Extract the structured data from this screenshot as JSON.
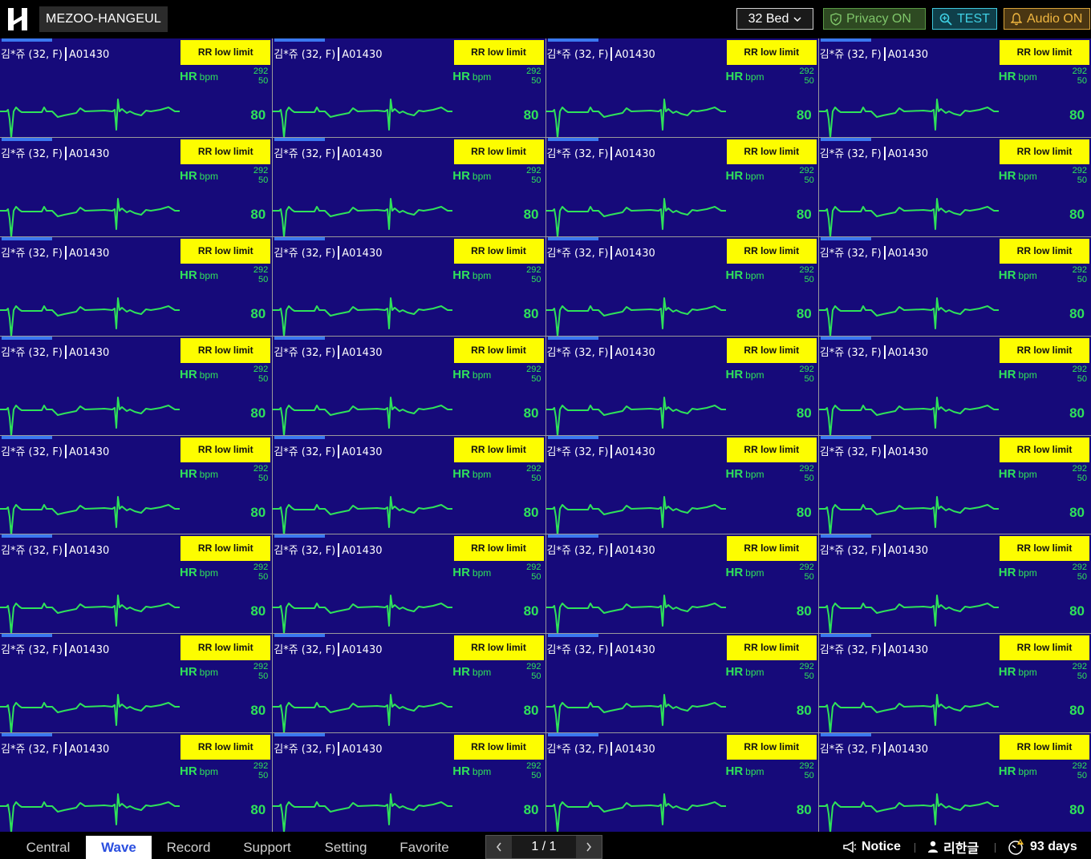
{
  "header": {
    "logo_icon": "h-logo-icon",
    "hospital_name": "MEZOO-HANGEUL",
    "bed_select": "32 Bed",
    "privacy_label": "Privacy ON",
    "test_label": "TEST",
    "audio_label": "Audio ON"
  },
  "patients": [
    {
      "name": "김*쥬 (32, F)",
      "id": "A01430",
      "alarm": "RR low limit",
      "hr_label": "HR",
      "hr_unit": "bpm",
      "hr_high": "292",
      "hr_low": "50",
      "hr_value": "80"
    },
    {
      "name": "김*쥬 (32, F)",
      "id": "A01430",
      "alarm": "RR low limit",
      "hr_label": "HR",
      "hr_unit": "bpm",
      "hr_high": "292",
      "hr_low": "50",
      "hr_value": "80"
    },
    {
      "name": "김*쥬 (32, F)",
      "id": "A01430",
      "alarm": "RR low limit",
      "hr_label": "HR",
      "hr_unit": "bpm",
      "hr_high": "292",
      "hr_low": "50",
      "hr_value": "80"
    },
    {
      "name": "김*쥬 (32, F)",
      "id": "A01430",
      "alarm": "RR low limit",
      "hr_label": "HR",
      "hr_unit": "bpm",
      "hr_high": "292",
      "hr_low": "50",
      "hr_value": "80"
    },
    {
      "name": "김*쥬 (32, F)",
      "id": "A01430",
      "alarm": "RR low limit",
      "hr_label": "HR",
      "hr_unit": "bpm",
      "hr_high": "292",
      "hr_low": "50",
      "hr_value": "80"
    },
    {
      "name": "김*쥬 (32, F)",
      "id": "A01430",
      "alarm": "RR low limit",
      "hr_label": "HR",
      "hr_unit": "bpm",
      "hr_high": "292",
      "hr_low": "50",
      "hr_value": "80"
    },
    {
      "name": "김*쥬 (32, F)",
      "id": "A01430",
      "alarm": "RR low limit",
      "hr_label": "HR",
      "hr_unit": "bpm",
      "hr_high": "292",
      "hr_low": "50",
      "hr_value": "80"
    },
    {
      "name": "김*쥬 (32, F)",
      "id": "A01430",
      "alarm": "RR low limit",
      "hr_label": "HR",
      "hr_unit": "bpm",
      "hr_high": "292",
      "hr_low": "50",
      "hr_value": "80"
    },
    {
      "name": "김*쥬 (32, F)",
      "id": "A01430",
      "alarm": "RR low limit",
      "hr_label": "HR",
      "hr_unit": "bpm",
      "hr_high": "292",
      "hr_low": "50",
      "hr_value": "80"
    },
    {
      "name": "김*쥬 (32, F)",
      "id": "A01430",
      "alarm": "RR low limit",
      "hr_label": "HR",
      "hr_unit": "bpm",
      "hr_high": "292",
      "hr_low": "50",
      "hr_value": "80"
    },
    {
      "name": "김*쥬 (32, F)",
      "id": "A01430",
      "alarm": "RR low limit",
      "hr_label": "HR",
      "hr_unit": "bpm",
      "hr_high": "292",
      "hr_low": "50",
      "hr_value": "80"
    },
    {
      "name": "김*쥬 (32, F)",
      "id": "A01430",
      "alarm": "RR low limit",
      "hr_label": "HR",
      "hr_unit": "bpm",
      "hr_high": "292",
      "hr_low": "50",
      "hr_value": "80"
    },
    {
      "name": "김*쥬 (32, F)",
      "id": "A01430",
      "alarm": "RR low limit",
      "hr_label": "HR",
      "hr_unit": "bpm",
      "hr_high": "292",
      "hr_low": "50",
      "hr_value": "80"
    },
    {
      "name": "김*쥬 (32, F)",
      "id": "A01430",
      "alarm": "RR low limit",
      "hr_label": "HR",
      "hr_unit": "bpm",
      "hr_high": "292",
      "hr_low": "50",
      "hr_value": "80"
    },
    {
      "name": "김*쥬 (32, F)",
      "id": "A01430",
      "alarm": "RR low limit",
      "hr_label": "HR",
      "hr_unit": "bpm",
      "hr_high": "292",
      "hr_low": "50",
      "hr_value": "80"
    },
    {
      "name": "김*쥬 (32, F)",
      "id": "A01430",
      "alarm": "RR low limit",
      "hr_label": "HR",
      "hr_unit": "bpm",
      "hr_high": "292",
      "hr_low": "50",
      "hr_value": "80"
    },
    {
      "name": "김*쥬 (32, F)",
      "id": "A01430",
      "alarm": "RR low limit",
      "hr_label": "HR",
      "hr_unit": "bpm",
      "hr_high": "292",
      "hr_low": "50",
      "hr_value": "80"
    },
    {
      "name": "김*쥬 (32, F)",
      "id": "A01430",
      "alarm": "RR low limit",
      "hr_label": "HR",
      "hr_unit": "bpm",
      "hr_high": "292",
      "hr_low": "50",
      "hr_value": "80"
    },
    {
      "name": "김*쥬 (32, F)",
      "id": "A01430",
      "alarm": "RR low limit",
      "hr_label": "HR",
      "hr_unit": "bpm",
      "hr_high": "292",
      "hr_low": "50",
      "hr_value": "80"
    },
    {
      "name": "김*쥬 (32, F)",
      "id": "A01430",
      "alarm": "RR low limit",
      "hr_label": "HR",
      "hr_unit": "bpm",
      "hr_high": "292",
      "hr_low": "50",
      "hr_value": "80"
    },
    {
      "name": "김*쥬 (32, F)",
      "id": "A01430",
      "alarm": "RR low limit",
      "hr_label": "HR",
      "hr_unit": "bpm",
      "hr_high": "292",
      "hr_low": "50",
      "hr_value": "80"
    },
    {
      "name": "김*쥬 (32, F)",
      "id": "A01430",
      "alarm": "RR low limit",
      "hr_label": "HR",
      "hr_unit": "bpm",
      "hr_high": "292",
      "hr_low": "50",
      "hr_value": "80"
    },
    {
      "name": "김*쥬 (32, F)",
      "id": "A01430",
      "alarm": "RR low limit",
      "hr_label": "HR",
      "hr_unit": "bpm",
      "hr_high": "292",
      "hr_low": "50",
      "hr_value": "80"
    },
    {
      "name": "김*쥬 (32, F)",
      "id": "A01430",
      "alarm": "RR low limit",
      "hr_label": "HR",
      "hr_unit": "bpm",
      "hr_high": "292",
      "hr_low": "50",
      "hr_value": "80"
    },
    {
      "name": "김*쥬 (32, F)",
      "id": "A01430",
      "alarm": "RR low limit",
      "hr_label": "HR",
      "hr_unit": "bpm",
      "hr_high": "292",
      "hr_low": "50",
      "hr_value": "80"
    },
    {
      "name": "김*쥬 (32, F)",
      "id": "A01430",
      "alarm": "RR low limit",
      "hr_label": "HR",
      "hr_unit": "bpm",
      "hr_high": "292",
      "hr_low": "50",
      "hr_value": "80"
    },
    {
      "name": "김*쥬 (32, F)",
      "id": "A01430",
      "alarm": "RR low limit",
      "hr_label": "HR",
      "hr_unit": "bpm",
      "hr_high": "292",
      "hr_low": "50",
      "hr_value": "80"
    },
    {
      "name": "김*쥬 (32, F)",
      "id": "A01430",
      "alarm": "RR low limit",
      "hr_label": "HR",
      "hr_unit": "bpm",
      "hr_high": "292",
      "hr_low": "50",
      "hr_value": "80"
    },
    {
      "name": "김*쥬 (32, F)",
      "id": "A01430",
      "alarm": "RR low limit",
      "hr_label": "HR",
      "hr_unit": "bpm",
      "hr_high": "292",
      "hr_low": "50",
      "hr_value": "80"
    },
    {
      "name": "김*쥬 (32, F)",
      "id": "A01430",
      "alarm": "RR low limit",
      "hr_label": "HR",
      "hr_unit": "bpm",
      "hr_high": "292",
      "hr_low": "50",
      "hr_value": "80"
    },
    {
      "name": "김*쥬 (32, F)",
      "id": "A01430",
      "alarm": "RR low limit",
      "hr_label": "HR",
      "hr_unit": "bpm",
      "hr_high": "292",
      "hr_low": "50",
      "hr_value": "80"
    },
    {
      "name": "김*쥬 (32, F)",
      "id": "A01430",
      "alarm": "RR low limit",
      "hr_label": "HR",
      "hr_unit": "bpm",
      "hr_high": "292",
      "hr_low": "50",
      "hr_value": "80"
    }
  ],
  "nav": {
    "tabs": [
      {
        "label": "Central",
        "active": false
      },
      {
        "label": "Wave",
        "active": true
      },
      {
        "label": "Record",
        "active": false
      },
      {
        "label": "Support",
        "active": false
      },
      {
        "label": "Setting",
        "active": false
      },
      {
        "label": "Favorite",
        "active": false
      }
    ],
    "pager": {
      "text": "1 / 1",
      "prev_icon": "chevron-left-icon",
      "next_icon": "chevron-right-icon"
    },
    "notice_label": "Notice",
    "user_label": "리한글",
    "days_label": "93 days"
  },
  "colors": {
    "cell_bg": "#160a7a",
    "wave": "#2fe25a",
    "alarm": "#fdfd00",
    "accent": "#2b4fe0"
  }
}
